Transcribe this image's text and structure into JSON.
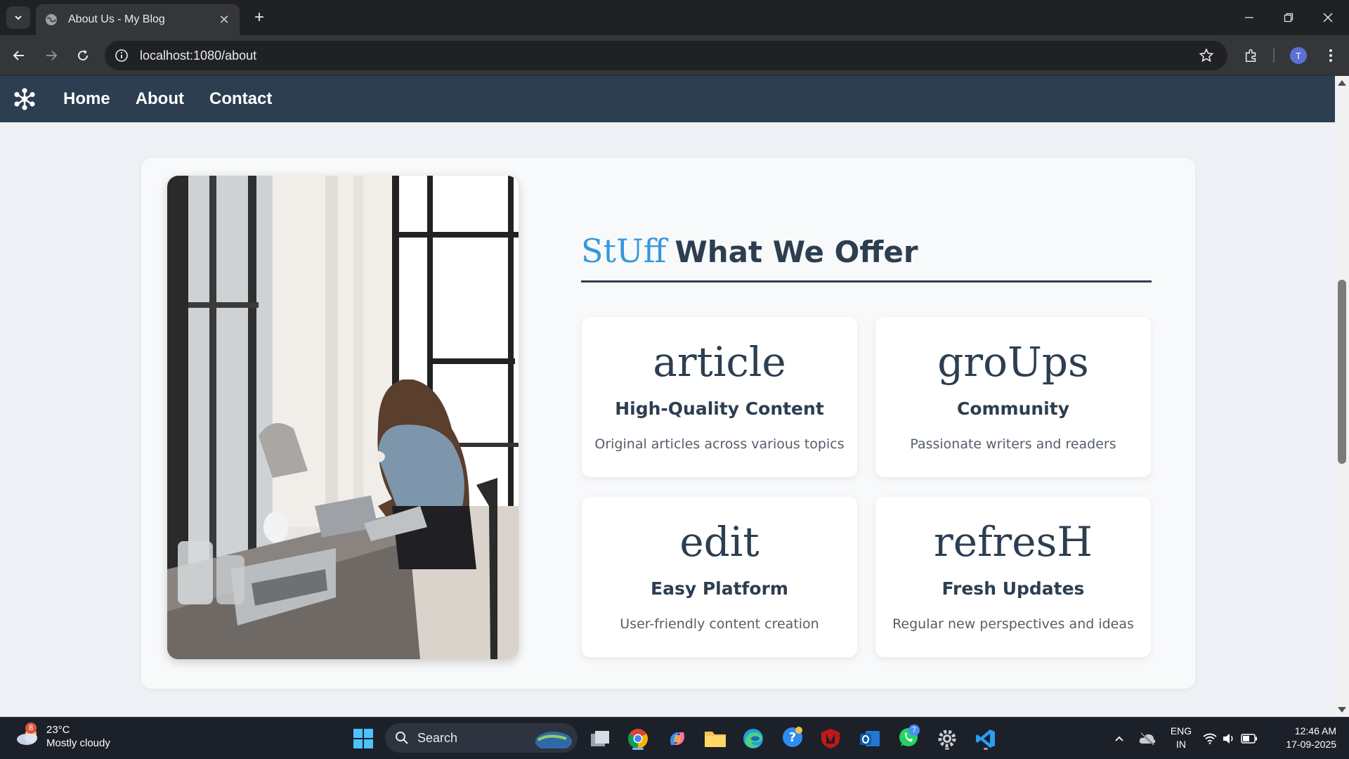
{
  "browser": {
    "tab_title": "About Us - My Blog",
    "url": "localhost:1080/about",
    "profile_initial": "T"
  },
  "site": {
    "nav": [
      {
        "label": "Home"
      },
      {
        "label": "About"
      },
      {
        "label": "Contact"
      }
    ]
  },
  "section": {
    "heading_icon": "StUff",
    "heading": "What We Offer",
    "features": [
      {
        "icon": "article",
        "title": "High-Quality Content",
        "desc": "Original articles across various topics"
      },
      {
        "icon": "groUps",
        "title": "Community",
        "desc": "Passionate writers and readers"
      },
      {
        "icon": "edit",
        "title": "Easy Platform",
        "desc": "User-friendly content creation"
      },
      {
        "icon": "refresH",
        "title": "Fresh Updates",
        "desc": "Regular new perspectives and ideas"
      }
    ]
  },
  "taskbar": {
    "weather_badge": "8",
    "temp": "23°C",
    "condition": "Mostly cloudy",
    "search_placeholder": "Search",
    "whatsapp_badge": "7",
    "lang_top": "ENG",
    "lang_bottom": "IN",
    "time": "12:46 AM",
    "date": "17-09-2025"
  },
  "colors": {
    "nav_bg": "#2c3e50",
    "accent": "#3498db",
    "text_dark": "#2c3e50"
  }
}
